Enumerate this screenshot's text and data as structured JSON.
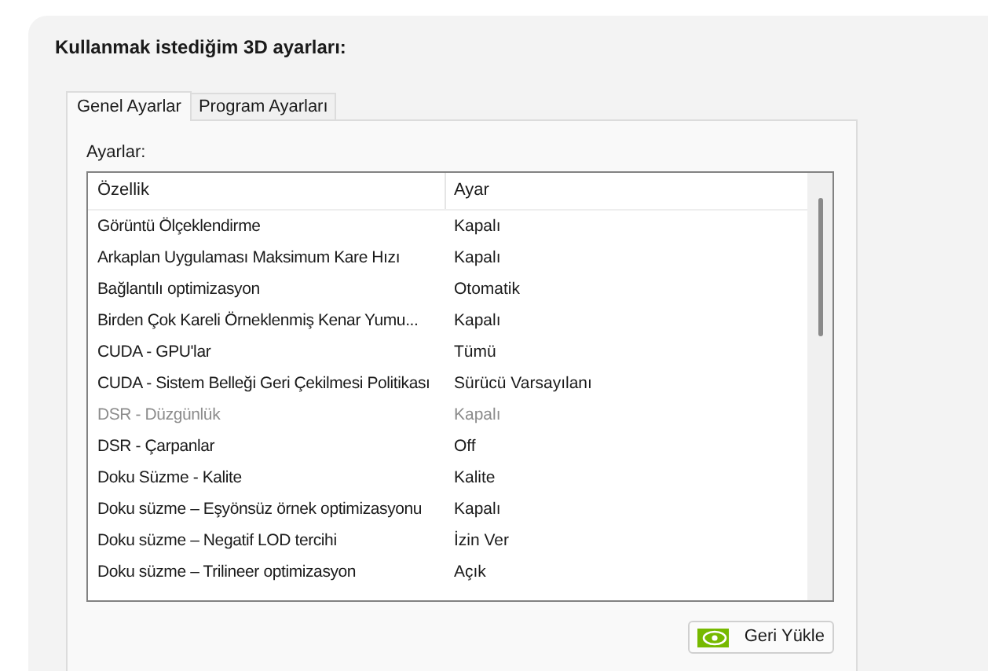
{
  "title": "Kullanmak istediğim 3D ayarları:",
  "tabs": [
    {
      "label": "Genel Ayarlar",
      "selected": true
    },
    {
      "label": "Program Ayarları",
      "selected": false
    }
  ],
  "section_label": "Ayarlar:",
  "table": {
    "columns": [
      "Özellik",
      "Ayar"
    ],
    "rows": [
      {
        "feature": "Görüntü Ölçeklendirme",
        "setting": "Kapalı",
        "disabled": false
      },
      {
        "feature": "Arkaplan Uygulaması Maksimum Kare Hızı",
        "setting": "Kapalı",
        "disabled": false
      },
      {
        "feature": "Bağlantılı optimizasyon",
        "setting": "Otomatik",
        "disabled": false
      },
      {
        "feature": "Birden Çok Kareli Örneklenmiş Kenar Yumu...",
        "setting": "Kapalı",
        "disabled": false
      },
      {
        "feature": "CUDA - GPU'lar",
        "setting": "Tümü",
        "disabled": false
      },
      {
        "feature": "CUDA - Sistem Belleği Geri Çekilmesi Politikası",
        "setting": "Sürücü Varsayılanı",
        "disabled": false
      },
      {
        "feature": "DSR - Düzgünlük",
        "setting": "Kapalı",
        "disabled": true
      },
      {
        "feature": "DSR - Çarpanlar",
        "setting": "Off",
        "disabled": false
      },
      {
        "feature": "Doku Süzme - Kalite",
        "setting": "Kalite",
        "disabled": false
      },
      {
        "feature": "Doku süzme – Eşyönsüz örnek optimizasyonu",
        "setting": "Kapalı",
        "disabled": false
      },
      {
        "feature": "Doku süzme – Negatif LOD tercihi",
        "setting": "İzin Ver",
        "disabled": false
      },
      {
        "feature": "Doku süzme – Trilineer optimizasyon",
        "setting": "Açık",
        "disabled": false
      }
    ]
  },
  "restore_button": "Geri Yükle"
}
